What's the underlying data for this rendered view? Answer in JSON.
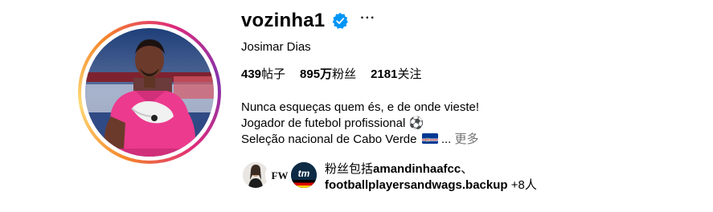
{
  "profile": {
    "username": "vozinha1",
    "full_name": "Josimar Dias",
    "verified_icon": "verified-badge-icon",
    "more_icon": "more-options-icon",
    "more_glyph": "···"
  },
  "stats": {
    "posts_value": "439",
    "posts_label": "帖子",
    "followers_value": "895万",
    "followers_label": "粉丝",
    "following_value": "2181",
    "following_label": "关注"
  },
  "bio": {
    "line1": "Nunca esqueças quem és, e de onde vieste!",
    "line2": "Jogador de futebol profissional",
    "line2_emoji": "⚽",
    "line3": "Seleção nacional de Cabo Verde",
    "line3_flag_icon": "cabo-verde-flag-icon",
    "ellipsis": "...",
    "more": "更多"
  },
  "followed_by": {
    "prefix": "粉丝包括",
    "user1": "amandinhaafcc",
    "separator": "、",
    "user2": "footballplayersandwags.backup",
    "suffix": " +8人",
    "avatar2_text": "FW",
    "avatar3_text": "tm"
  },
  "colors": {
    "verified_blue": "#0095f6",
    "secondary_text": "#737373",
    "ring_gradient": [
      "#f58529",
      "#feda77",
      "#dd2a7b",
      "#8134af"
    ]
  }
}
